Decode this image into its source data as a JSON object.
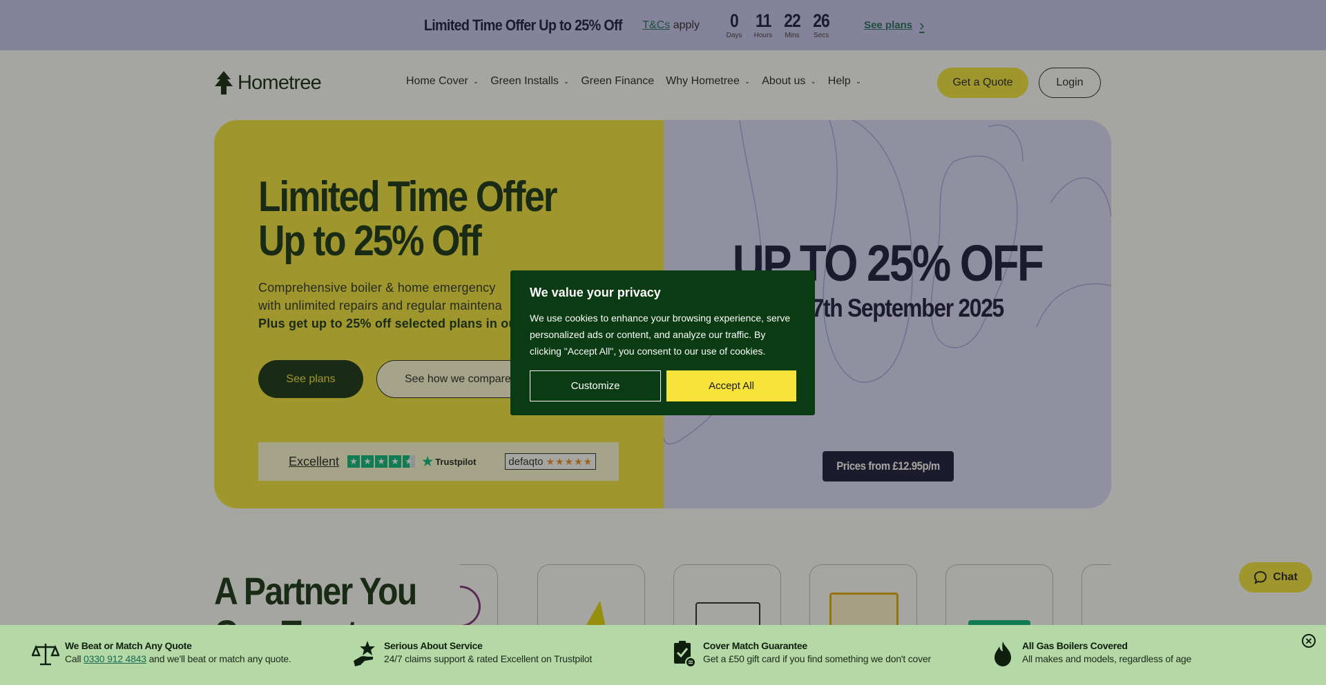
{
  "promo": {
    "title": "Limited Time Offer Up to 25% Off",
    "tcs_link": "T&Cs",
    "tcs_suffix": "apply",
    "countdown": [
      {
        "value": "0",
        "label": "Days"
      },
      {
        "value": "11",
        "label": "Hours"
      },
      {
        "value": "22",
        "label": "Mins"
      },
      {
        "value": "26",
        "label": "Secs"
      }
    ],
    "see_plans": "See plans"
  },
  "nav": {
    "logo": "Hometree",
    "menu": [
      {
        "label": "Home Cover",
        "dropdown": true
      },
      {
        "label": "Green Installs",
        "dropdown": true
      },
      {
        "label": "Green Finance",
        "dropdown": false
      },
      {
        "label": "Why Hometree",
        "dropdown": true
      },
      {
        "label": "About us",
        "dropdown": true
      },
      {
        "label": "Help",
        "dropdown": true
      }
    ],
    "quote_button": "Get a Quote",
    "login_button": "Login"
  },
  "hero": {
    "title": "Limited Time Offer Up to 25% Off",
    "desc_line1": "Comprehensive boiler & home emergency",
    "desc_line2": "with unlimited repairs and regular maintena",
    "desc_line3": "Plus get up to 25% off selected plans in ou",
    "see_plans_button": "See plans",
    "compare_button": "See how we compare",
    "rating_excellent": "Excellent",
    "trustpilot": "Trustpilot",
    "defaqto": "defaqto",
    "big_offer": "UP TO 25% OFF",
    "ends": "ds 17th September 2025",
    "price_badge": "Prices from £12.95p/m"
  },
  "partner": {
    "title": "A Partner You",
    "title_line2": "Can Trust"
  },
  "chat": {
    "label": "Chat"
  },
  "cookie": {
    "title": "We value your privacy",
    "body": "We use cookies to enhance your browsing experience, serve personalized ads or content, and analyze our traffic. By clicking \"Accept All\", you consent to our use of cookies.",
    "customize": "Customize",
    "accept": "Accept All"
  },
  "benefits": [
    {
      "icon": "scales-icon",
      "title": "We Beat or Match Any Quote",
      "pre": "Call",
      "phone": "0330 912 4843",
      "post": "and we'll beat or match any quote."
    },
    {
      "icon": "hand-star-icon",
      "title": "Serious About Service",
      "text": "24/7 claims support & rated Excellent on Trustpilot"
    },
    {
      "icon": "clipboard-check-icon",
      "title": "Cover Match Guarantee",
      "text": "Get a £50 gift card if you find something we don't cover"
    },
    {
      "icon": "flame-icon",
      "title": "All Gas Boilers Covered",
      "text": "All makes and models, regardless of age"
    }
  ],
  "colors": {
    "promo_bg": "#c9c3f4",
    "accent_yellow": "#f7e33a",
    "dark_green": "#0e2a0e",
    "lavender": "#ddd9fd",
    "navy": "#14103a",
    "cookie_bg": "#0a3b12",
    "benefits_bg": "#b4d9a6"
  }
}
